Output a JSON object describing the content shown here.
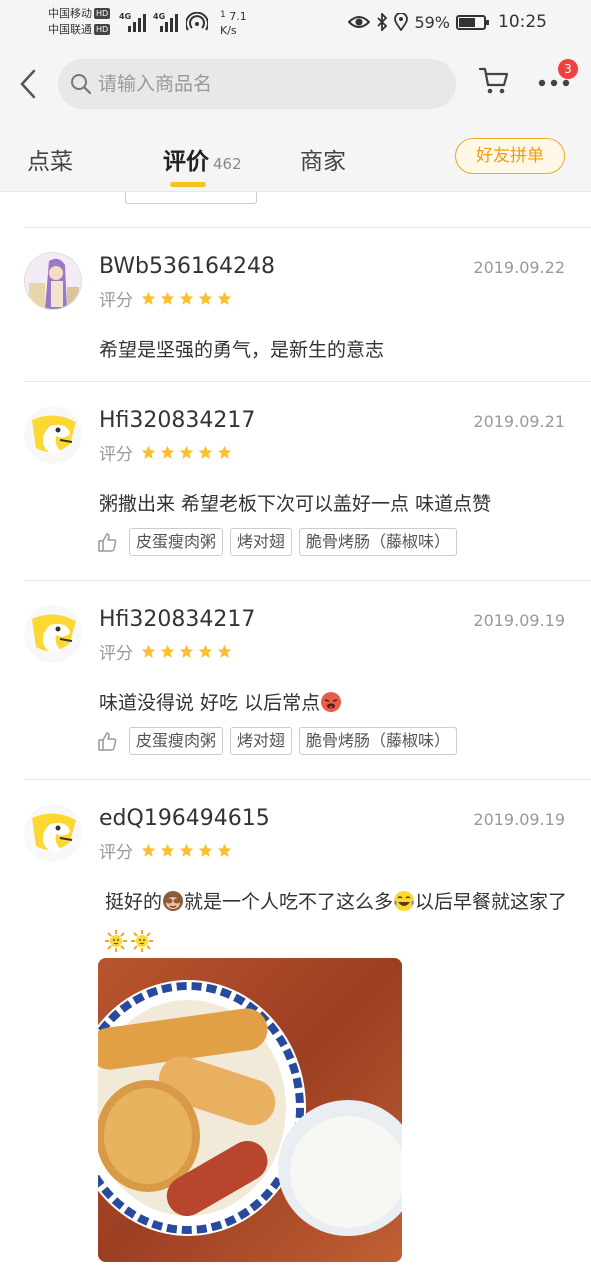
{
  "status_bar": {
    "carrier1": "中国移动",
    "carrier2": "中国联通",
    "hd_badge": "HD",
    "net_type": "4G",
    "speed_value": "7.1",
    "speed_unit": "K/s",
    "speed_count": "1",
    "battery": "59%",
    "time": "10:25"
  },
  "header": {
    "search_placeholder": "请输入商品名",
    "cart_badge": "3",
    "tabs": [
      {
        "label": "点菜"
      },
      {
        "label": "评价",
        "count": "462"
      },
      {
        "label": "商家"
      }
    ],
    "group_button": "好友拼单"
  },
  "reviews": [
    {
      "username": "BWb536164248",
      "date": "2019.09.22",
      "rating_label": "评分",
      "stars": 5,
      "text": "希望是坚强的勇气，是新生的意志",
      "tags": []
    },
    {
      "username": "Hfi320834217",
      "date": "2019.09.21",
      "rating_label": "评分",
      "stars": 5,
      "text": "粥撒出来 希望老板下次可以盖好一点 味道点赞",
      "tags": [
        "皮蛋瘦肉粥",
        "烤对翅",
        "脆骨烤肠（藤椒味）"
      ]
    },
    {
      "username": "Hfi320834217",
      "date": "2019.09.19",
      "rating_label": "评分",
      "stars": 5,
      "text": "味道没得说 好吃 以后常点",
      "tags": [
        "皮蛋瘦肉粥",
        "烤对翅",
        "脆骨烤肠（藤椒味）"
      ]
    },
    {
      "username": "edQ196494615",
      "date": "2019.09.19",
      "rating_label": "评分",
      "stars": 5,
      "text_part1": "挺好的",
      "text_part2": "就是一个人吃不了这么多",
      "text_part3": "以后早餐就这家了",
      "tags": []
    }
  ]
}
